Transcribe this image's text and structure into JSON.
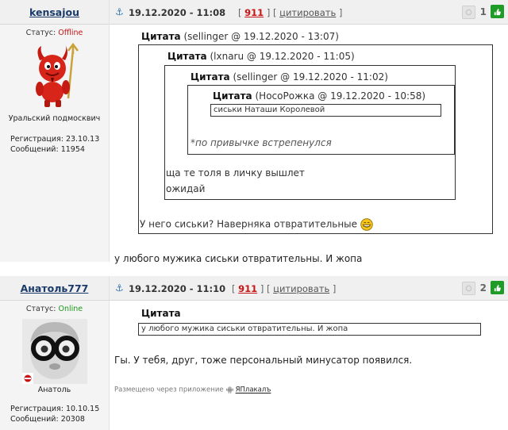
{
  "post1": {
    "user": {
      "name": "kensajou",
      "status_label": "Статус:",
      "status_value": "Offline",
      "location": "Уральский подмосквич",
      "reg_label": "Регистрация:",
      "reg_date": "23.10.13",
      "msgs_label": "Сообщений:",
      "msgs_count": "11954"
    },
    "date": "19.12.2020 - 11:08",
    "reply_count": "911",
    "quote_label": "цитировать",
    "rating": "1",
    "quotes": {
      "outer": {
        "label": "Цитата",
        "meta": "(sellinger @ 19.12.2020 - 13:07)",
        "text": "У него сиськи? Наверняка отвратительные"
      },
      "mid": {
        "label": "Цитата",
        "meta": "(lxnaru @ 19.12.2020 - 11:05)",
        "line1": "ща те толя в личку вышлет",
        "line2": "ожидай"
      },
      "inner": {
        "label": "Цитата",
        "meta": "(sellinger @ 19.12.2020 - 11:02)",
        "text": "*по привычке встрепенулся"
      },
      "innermost": {
        "label": "Цитата",
        "meta": "(НосоРожка @ 19.12.2020 - 10:58)",
        "text": "сиськи Наташи Королевой"
      }
    },
    "message": "у любого мужика сиськи отвратительны. И жопа"
  },
  "post2": {
    "user": {
      "name": "Анатоль777",
      "status_label": "Статус:",
      "status_value": "Online",
      "location": "Анатоль",
      "reg_label": "Регистрация:",
      "reg_date": "10.10.15",
      "msgs_label": "Сообщений:",
      "msgs_count": "20308"
    },
    "date": "19.12.2020 - 11:10",
    "reply_count": "911",
    "quote_label": "цитировать",
    "rating": "2",
    "quote": {
      "label": "Цитата",
      "text": "у любого мужика сиськи отвратительны. И жопа"
    },
    "message": "Гы. У тебя, друг, тоже персональный минусатор появился.",
    "via_text": "Размещено через приложение",
    "via_app": "ЯПлакалъ"
  },
  "colors": {
    "offline": "#c81414",
    "online": "#1a9a1a",
    "reply_count": "#c81414",
    "plus_button": "#1f9b28",
    "username": "#1a3a6a"
  },
  "icons": [
    "anchor-icon",
    "minus-icon",
    "plus-icon",
    "smiley-icon",
    "android-icon",
    "devil-avatar",
    "baby-glasses-avatar"
  ]
}
